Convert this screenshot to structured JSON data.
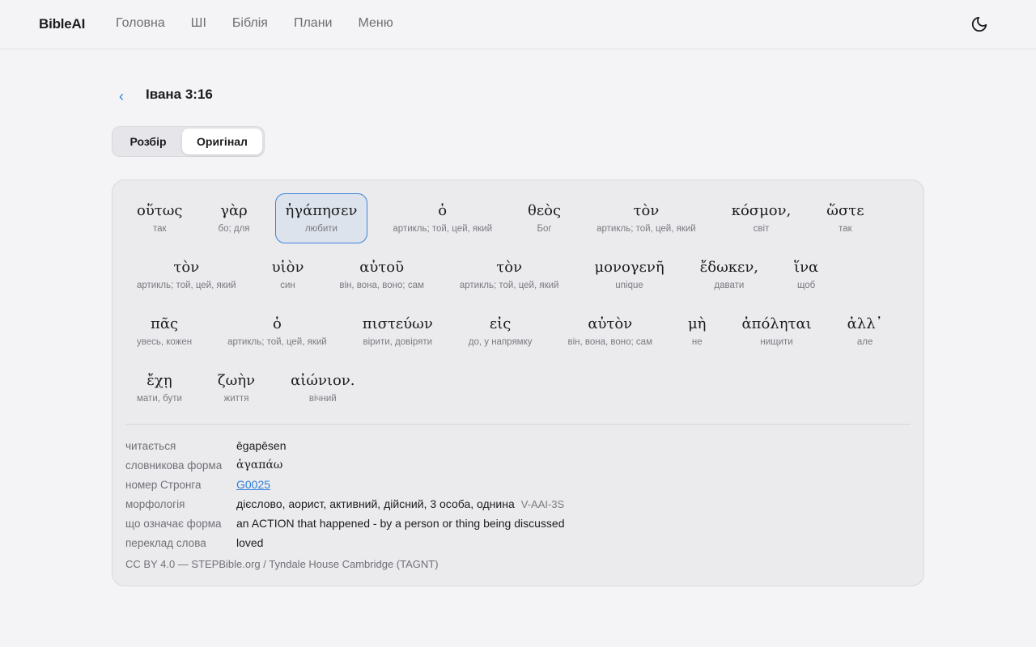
{
  "brand": "BibleAI",
  "nav": [
    "Головна",
    "ШІ",
    "Біблія",
    "Плани",
    "Меню"
  ],
  "header": {
    "back_icon": "‹",
    "title": "Івана 3:16"
  },
  "tabs": {
    "first": "Розбір",
    "second": "Оригінал",
    "active": "Оригінал"
  },
  "words": [
    {
      "gk": "οὕτως",
      "gl": "так"
    },
    {
      "gk": "γὰρ",
      "gl": "бо; для"
    },
    {
      "gk": "ἠγάπησεν",
      "gl": "любити",
      "selected": true
    },
    {
      "gk": "ὁ",
      "gl": "артикль; той, цей, який"
    },
    {
      "gk": "θεὸς",
      "gl": "Бог"
    },
    {
      "gk": "τὸν",
      "gl": "артикль; той, цей, який"
    },
    {
      "gk": "κόσμον,",
      "gl": "світ"
    },
    {
      "gk": "ὥστε",
      "gl": "так"
    },
    {
      "gk": "τὸν",
      "gl": "артикль; той, цей, який"
    },
    {
      "gk": "υἱὸν",
      "gl": "син"
    },
    {
      "gk": "αὐτοῦ",
      "gl": "він, вона, воно; сам"
    },
    {
      "gk": "τὸν",
      "gl": "артикль; той, цей, який"
    },
    {
      "gk": "μονογενῆ",
      "gl": "unique"
    },
    {
      "gk": "ἔδωκεν,",
      "gl": "давати"
    },
    {
      "gk": "ἵνα",
      "gl": "щоб"
    },
    {
      "gk": "πᾶς",
      "gl": "увесь, кожен"
    },
    {
      "gk": "ὁ",
      "gl": "артикль; той, цей, який"
    },
    {
      "gk": "πιστεύων",
      "gl": "вірити, довіряти"
    },
    {
      "gk": "εἰς",
      "gl": "до, у напрямку"
    },
    {
      "gk": "αὐτὸν",
      "gl": "він, вона, воно; сам"
    },
    {
      "gk": "μὴ",
      "gl": "не"
    },
    {
      "gk": "ἀπόληται",
      "gl": "нищити"
    },
    {
      "gk": "ἀλλ᾽",
      "gl": "але"
    },
    {
      "gk": "ἔχῃ",
      "gl": "мати, бути"
    },
    {
      "gk": "ζωὴν",
      "gl": "життя"
    },
    {
      "gk": "αἰώνιον.",
      "gl": "вічний"
    }
  ],
  "details": {
    "reading_label": "читається",
    "reading": "ēgapēsen",
    "lemma_label": "словникова форма",
    "lemma": "ἀγαπάω",
    "strong_label": "номер Стронга",
    "strong": "G0025",
    "morph_label": "морфологія",
    "morph": "дієслово, аорист, активний, дійсний, 3 особа, однина",
    "morph_code": "V-AAI-3S",
    "meaning_label": "що означає форма",
    "meaning": "an ACTION that happened - by a person or thing being discussed",
    "translation_label": "переклад слова",
    "translation": "loved"
  },
  "footer": "CC BY 4.0 — STEPBible.org / Tyndale House Cambridge (TAGNT)",
  "colors": {
    "accent": "#2f7fd8",
    "selected_bg": "#dde3ec",
    "card_bg": "#ebebee"
  }
}
